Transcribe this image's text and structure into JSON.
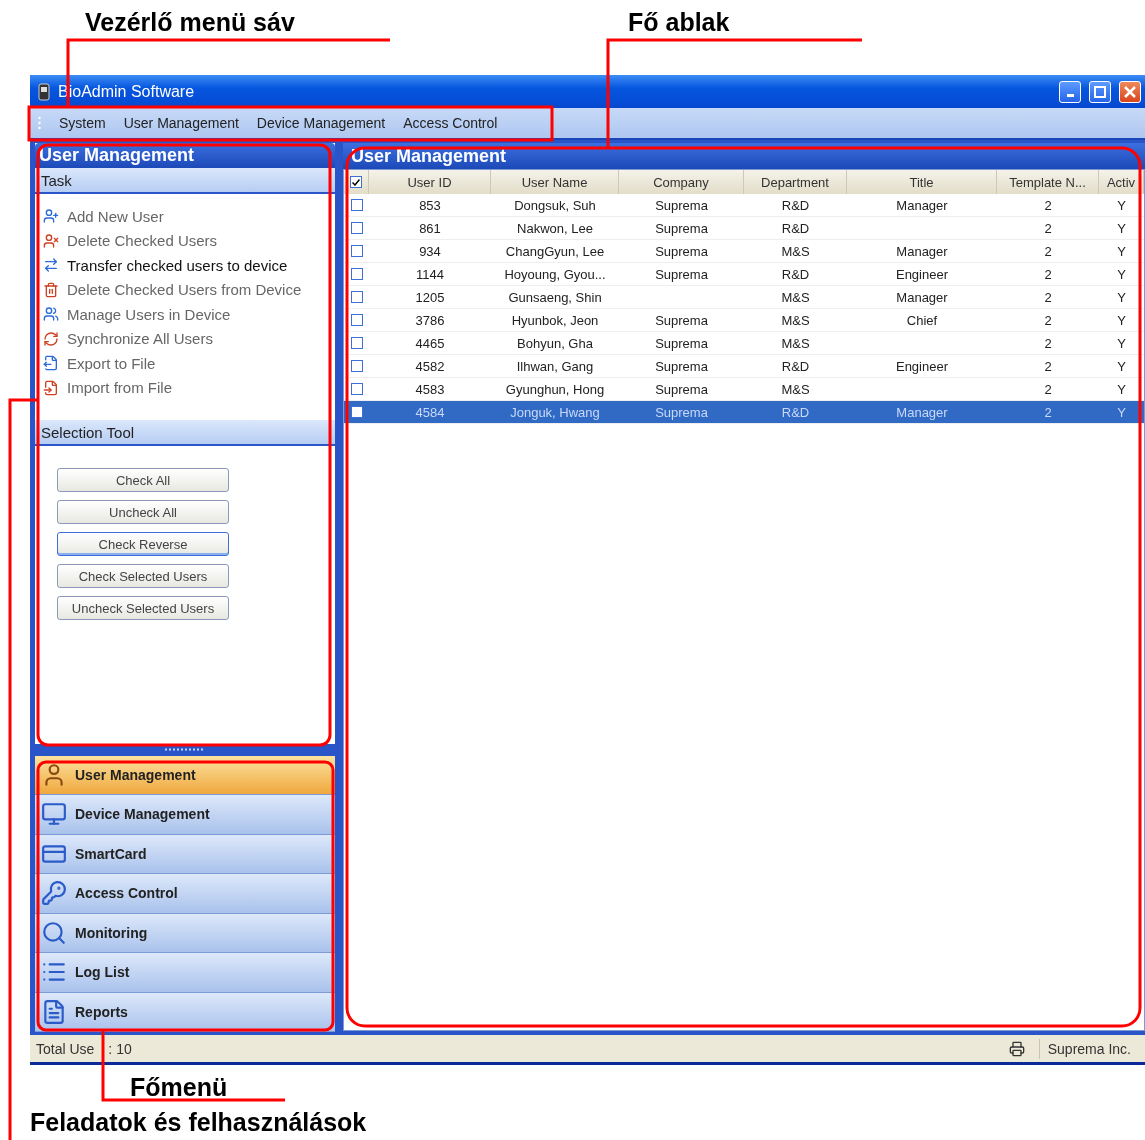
{
  "callouts": {
    "menu_bar": "Vezérlő menü sáv",
    "main_window": "Fő ablak",
    "main_menu": "Főmenü",
    "tasks": "Feladatok és felhasználások"
  },
  "window": {
    "title": "BioAdmin Software"
  },
  "menu": [
    "System",
    "User Management",
    "Device Management",
    "Access Control"
  ],
  "task_panel": {
    "title": "User Management",
    "task_header": "Task",
    "tasks": [
      {
        "label": "Add New User",
        "highlighted": false
      },
      {
        "label": "Delete Checked Users",
        "highlighted": false
      },
      {
        "label": "Transfer checked users to device",
        "highlighted": true
      },
      {
        "label": "Delete Checked Users from Device",
        "highlighted": false
      },
      {
        "label": "Manage Users in Device",
        "highlighted": false
      },
      {
        "label": "Synchronize All Users",
        "highlighted": false
      },
      {
        "label": "Export to File",
        "highlighted": false
      },
      {
        "label": "Import from File",
        "highlighted": false
      }
    ],
    "selection_header": "Selection Tool",
    "buttons": [
      {
        "label": "Check All",
        "focused": false
      },
      {
        "label": "Uncheck All",
        "focused": false
      },
      {
        "label": "Check Reverse",
        "focused": true
      },
      {
        "label": "Check Selected Users",
        "focused": false
      },
      {
        "label": "Uncheck Selected Users",
        "focused": false
      }
    ]
  },
  "nav": {
    "items": [
      {
        "label": "User Management",
        "selected": true
      },
      {
        "label": "Device Management",
        "selected": false
      },
      {
        "label": "SmartCard",
        "selected": false
      },
      {
        "label": "Access Control",
        "selected": false
      },
      {
        "label": "Monitoring",
        "selected": false
      },
      {
        "label": "Log List",
        "selected": false
      },
      {
        "label": "Reports",
        "selected": false
      }
    ]
  },
  "main": {
    "title": "User Management",
    "table": {
      "all_checked": true,
      "columns": [
        "User ID",
        "User Name",
        "Company",
        "Department",
        "Title",
        "Template N...",
        "Activ"
      ],
      "rows": [
        {
          "cells": [
            "853",
            "Dongsuk, Suh",
            "Suprema",
            "R&D",
            "Manager",
            "2",
            "Y"
          ],
          "checked": false,
          "selected": false
        },
        {
          "cells": [
            "861",
            "Nakwon, Lee",
            "Suprema",
            "R&D",
            null,
            "2",
            "Y"
          ],
          "checked": false,
          "selected": false
        },
        {
          "cells": [
            "934",
            "ChangGyun, Lee",
            "Suprema",
            "M&S",
            "Manager",
            "2",
            "Y"
          ],
          "checked": false,
          "selected": false
        },
        {
          "cells": [
            "1144",
            "Hoyoung, Gyou...",
            "Suprema",
            "R&D",
            "Engineer",
            "2",
            "Y"
          ],
          "checked": false,
          "selected": false
        },
        {
          "cells": [
            "1205",
            "Gunsaeng, Shin",
            null,
            "M&S",
            "Manager",
            "2",
            "Y"
          ],
          "checked": false,
          "selected": false
        },
        {
          "cells": [
            "3786",
            "Hyunbok, Jeon",
            "Suprema",
            "M&S",
            "Chief",
            "2",
            "Y"
          ],
          "checked": false,
          "selected": false
        },
        {
          "cells": [
            "4465",
            "Bohyun, Gha",
            "Suprema",
            "M&S",
            null,
            "2",
            "Y"
          ],
          "checked": false,
          "selected": false
        },
        {
          "cells": [
            "4582",
            "Ilhwan, Gang",
            "Suprema",
            "R&D",
            "Engineer",
            "2",
            "Y"
          ],
          "checked": false,
          "selected": false
        },
        {
          "cells": [
            "4583",
            "Gyunghun, Hong",
            "Suprema",
            "M&S",
            null,
            "2",
            "Y"
          ],
          "checked": false,
          "selected": false
        },
        {
          "cells": [
            "4584",
            "Jonguk, Hwang",
            "Suprema",
            "R&D",
            "Manager",
            "2",
            "Y"
          ],
          "checked": false,
          "selected": true
        }
      ]
    }
  },
  "status_bar": {
    "label": "Total Use",
    "count": ": 10",
    "company": "Suprema Inc."
  }
}
